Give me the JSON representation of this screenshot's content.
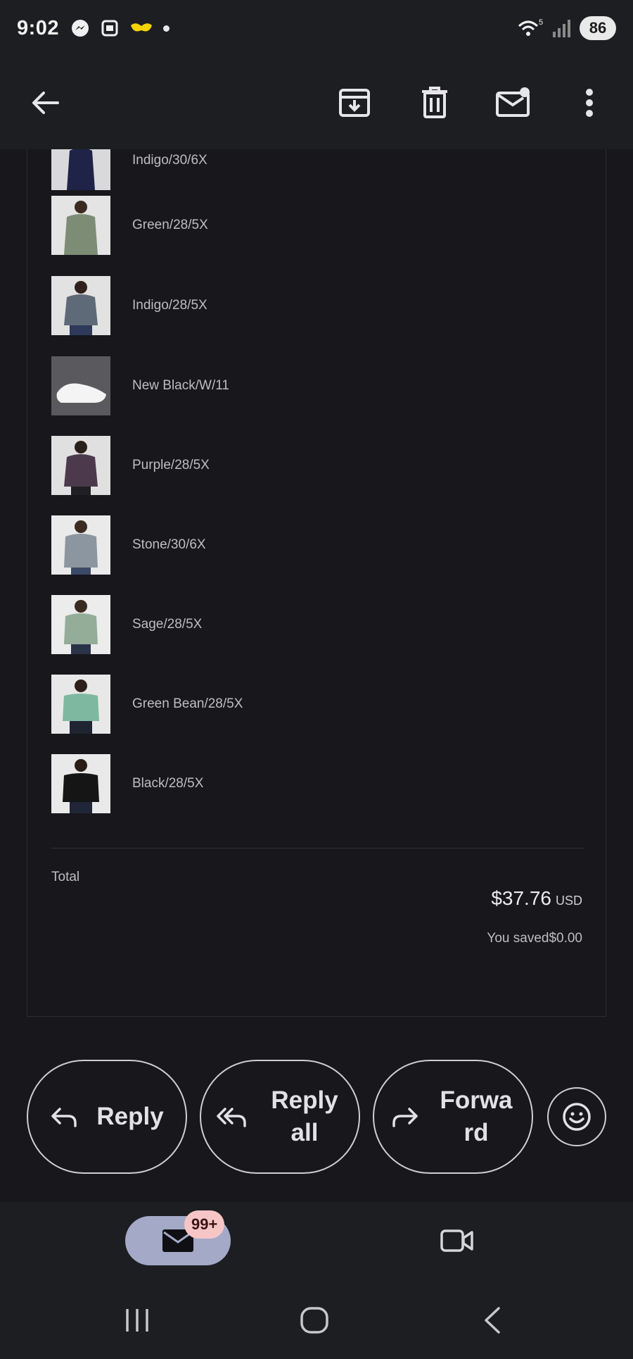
{
  "status_bar": {
    "time": "9:02",
    "network": "5",
    "battery": "86"
  },
  "toolbar": {
    "back": "back-arrow-icon",
    "archive": "archive-icon",
    "delete": "trash-icon",
    "mark_unread": "mark-unread-icon",
    "more": "more-vertical-icon"
  },
  "order": {
    "items": [
      {
        "variant": "Indigo/30/6X"
      },
      {
        "variant": "Green/28/5X"
      },
      {
        "variant": "Indigo/28/5X"
      },
      {
        "variant": "New Black/W/11"
      },
      {
        "variant": "Purple/28/5X"
      },
      {
        "variant": "Stone/30/6X"
      },
      {
        "variant": "Sage/28/5X"
      },
      {
        "variant": "Green Bean/28/5X"
      },
      {
        "variant": "Black/28/5X"
      }
    ],
    "total_label": "Total",
    "total_value": "$37.76",
    "total_currency": "USD",
    "saved_text": "You saved$0.00"
  },
  "actions": {
    "reply": "Reply",
    "reply_all": "Reply all",
    "forward": "Forward"
  },
  "bottom_nav": {
    "mail_badge": "99+"
  },
  "colors": {
    "background": "#17171c",
    "toolbar": "#1d1e22",
    "mail_pill": "#a4a9c7",
    "badge": "#f6c6c6"
  }
}
